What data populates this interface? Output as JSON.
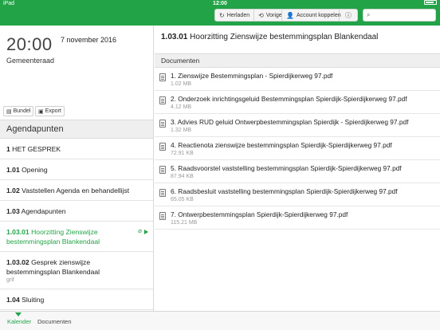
{
  "status": {
    "device": "iPad",
    "time": "12:00"
  },
  "toolbar": {
    "reload": "Herladen",
    "previous": "Vorige",
    "link_account": "Account koppelen",
    "search_placeholder": ""
  },
  "meeting": {
    "time": "20:00",
    "date": "7 november 2016",
    "name": "Gemeenteraad"
  },
  "actions": {
    "bundle": "Bundel",
    "export": "Export"
  },
  "agenda": {
    "heading": "Agendapunten",
    "items": [
      {
        "num": "1",
        "title": "HET GESPREK",
        "sub": ""
      },
      {
        "num": "1.01",
        "title": "Opening",
        "sub": ""
      },
      {
        "num": "1.02",
        "title": "Vaststellen Agenda en behandellijst",
        "sub": ""
      },
      {
        "num": "1.03",
        "title": "Agendapunten",
        "sub": ""
      },
      {
        "num": "1.03.01",
        "title": "Hoorzitting Zienswijze bestemmingsplan Blankendaal",
        "sub": ""
      },
      {
        "num": "1.03.02",
        "title": "Gesprek zienswijze bestemmingsplan Blankendaal",
        "sub": "grif"
      },
      {
        "num": "1.04",
        "title": "Sluiting",
        "sub": ""
      }
    ]
  },
  "detail": {
    "num": "1.03.01",
    "title": "Hoorzitting Zienswijze bestemmingsplan Blankendaal",
    "documents_heading": "Documenten",
    "documents": [
      {
        "name": "1. Zienswijze Bestemmingsplan - Spierdijkerweg 97.pdf",
        "size": "1.02 MB"
      },
      {
        "name": "2. Onderzoek inrichtingsgeluid Bestemmingsplan Spierdijk-Spierdijkerweg 97.pdf",
        "size": "4.12 MB"
      },
      {
        "name": "3. Advies RUD geluid Ontwerpbestemmingsplan Spierdijk - Spierdijkerweg 97.pdf",
        "size": "1.32 MB"
      },
      {
        "name": "4. Reactienota zienswijze bestemmingsplan Spierdijk-Spierdijkerweg 97.pdf",
        "size": "72.91 KB"
      },
      {
        "name": "5. Raadsvoorstel vaststelling bestemmingsplan Spierdijk-Spierdijkerweg 97.pdf",
        "size": "87.94 KB"
      },
      {
        "name": "6. Raadsbesluit vaststelling bestemmingsplan Spierdijk-Spierdijkerweg 97.pdf",
        "size": "65.05 KB"
      },
      {
        "name": "7. Ontwerpbestemmingsplan Spierdijk-Spierdijkerweg 97.pdf",
        "size": "115.21 MB"
      }
    ]
  },
  "bottom_tabs": {
    "calendar": "Kalender",
    "documents": "Documenten"
  },
  "colors": {
    "accent": "#23a348"
  }
}
